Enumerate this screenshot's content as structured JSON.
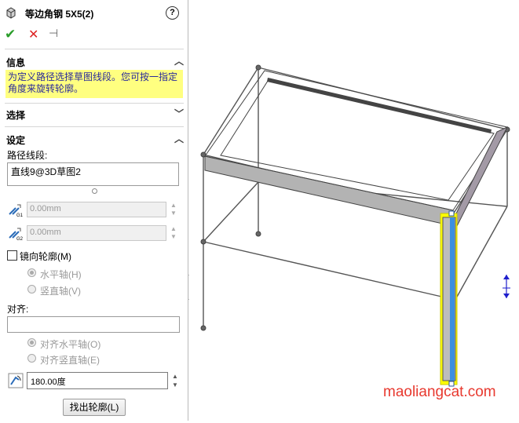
{
  "panel": {
    "title": "等边角钢 5X5(2)",
    "help": "?",
    "actions": {
      "ok": "✔",
      "cancel": "✕",
      "pin": "⊣"
    },
    "info": {
      "header": "信息",
      "text": "为定义路径选择草图线段。您可按一指定角度来旋转轮廓。"
    },
    "selection": {
      "header": "选择"
    },
    "settings": {
      "header": "设定",
      "path_label": "路径线段:",
      "path_items": [
        "直线9@3D草图2"
      ],
      "g1_value": "0.00mm",
      "g2_value": "0.00mm",
      "g1_tag": "G1",
      "g2_tag": "G2",
      "mirror_label": "镜向轮廓(M)",
      "horizontal_axis": "水平轴(H)",
      "vertical_axis": "竖直轴(V)",
      "align_label": "对齐:",
      "align_horizontal": "对齐水平轴(O)",
      "align_vertical": "对齐竖直轴(E)",
      "angle_value": "180.00度",
      "find_profile": "找出轮廓(L)"
    }
  },
  "viewport": {
    "watermark": "maoliangcat.com"
  },
  "colors": {
    "highlight": "#ffff00",
    "selected_member": "#3c8fe0",
    "arrow": "#e8392f"
  }
}
